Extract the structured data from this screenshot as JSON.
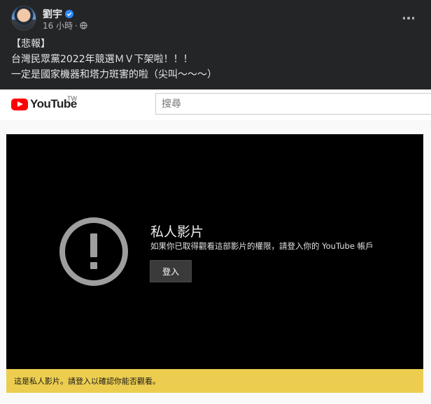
{
  "post": {
    "author": "劉宇",
    "time": "16 小時",
    "time_separator": "·",
    "lines": [
      "【悲報】",
      "台灣民眾黨2022年競選ＭＶ下架啦！！！",
      "一定是國家機器和塔力斑害的啦（尖叫～～～）"
    ]
  },
  "youtube": {
    "logo_text": "YouTube",
    "region": "TW",
    "search_placeholder": "搜尋"
  },
  "video": {
    "title": "私人影片",
    "message": "如果你已取得觀看這部影片的權限，請登入你的 YouTube 帳戶",
    "login_label": "登入",
    "notice": "這是私人影片。請登入以確認你能否觀看。"
  },
  "colors": {
    "background": "#242526",
    "notice_bar": "#eccd4f",
    "youtube_red": "#ff0000",
    "verified_blue": "#2d88ff"
  }
}
